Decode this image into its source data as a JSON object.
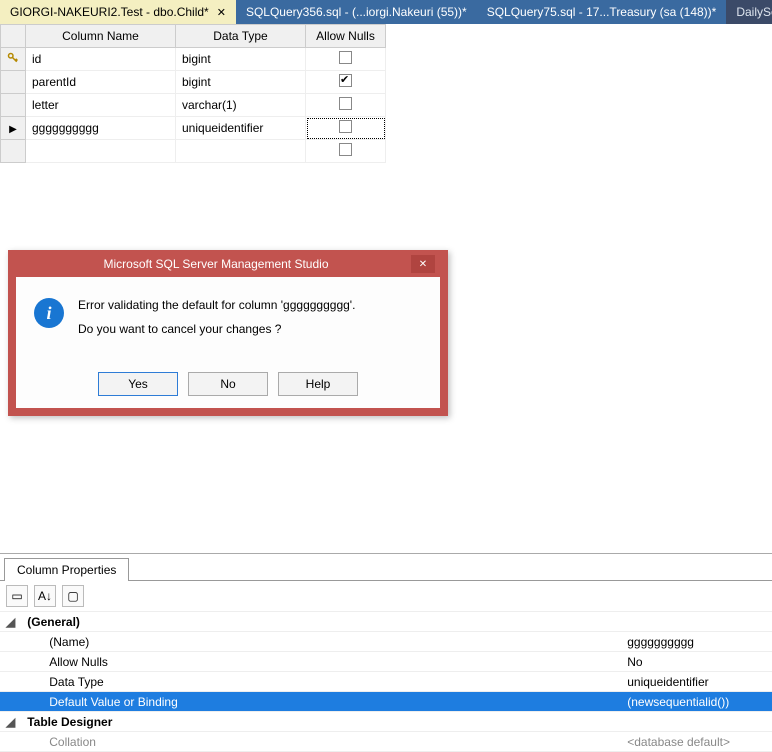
{
  "tabs": [
    {
      "label": "GIORGI-NAKEURI2.Test - dbo.Child*",
      "active": true
    },
    {
      "label": "SQLQuery356.sql - (...iorgi.Nakeuri (55))*"
    },
    {
      "label": "SQLQuery75.sql - 17...Treasury (sa (148))*"
    },
    {
      "label": "DailySelect"
    }
  ],
  "designer": {
    "headers": {
      "col": "Column Name",
      "dt": "Data Type",
      "nulls": "Allow Nulls"
    },
    "rows": [
      {
        "icon": "key",
        "name": "id",
        "type": "bigint",
        "nulls": false
      },
      {
        "icon": "",
        "name": "parentId",
        "type": "bigint",
        "nulls": true
      },
      {
        "icon": "",
        "name": "letter",
        "type": "varchar(1)",
        "nulls": false
      },
      {
        "icon": "arrow",
        "name": "gggggggggg",
        "type": "uniqueidentifier",
        "nulls": false,
        "focus": true
      },
      {
        "icon": "",
        "name": "",
        "type": "",
        "nulls": false
      }
    ]
  },
  "dialog": {
    "title": "Microsoft SQL Server Management Studio",
    "line1": "Error validating the default for column 'gggggggggg'.",
    "line2": "Do you want to cancel your changes ?",
    "buttons": {
      "yes": "Yes",
      "no": "No",
      "help": "Help"
    }
  },
  "props": {
    "tab": "Column Properties",
    "cat1": "(General)",
    "rows": [
      {
        "label": "(Name)",
        "value": "gggggggggg"
      },
      {
        "label": "Allow Nulls",
        "value": "No"
      },
      {
        "label": "Data Type",
        "value": "uniqueidentifier"
      },
      {
        "label": "Default Value or Binding",
        "value": "(newsequentialid())",
        "selected": true
      }
    ],
    "cat2": "Table Designer",
    "rows2": [
      {
        "label": "Collation",
        "value": "<database default>",
        "dim": true
      }
    ]
  }
}
